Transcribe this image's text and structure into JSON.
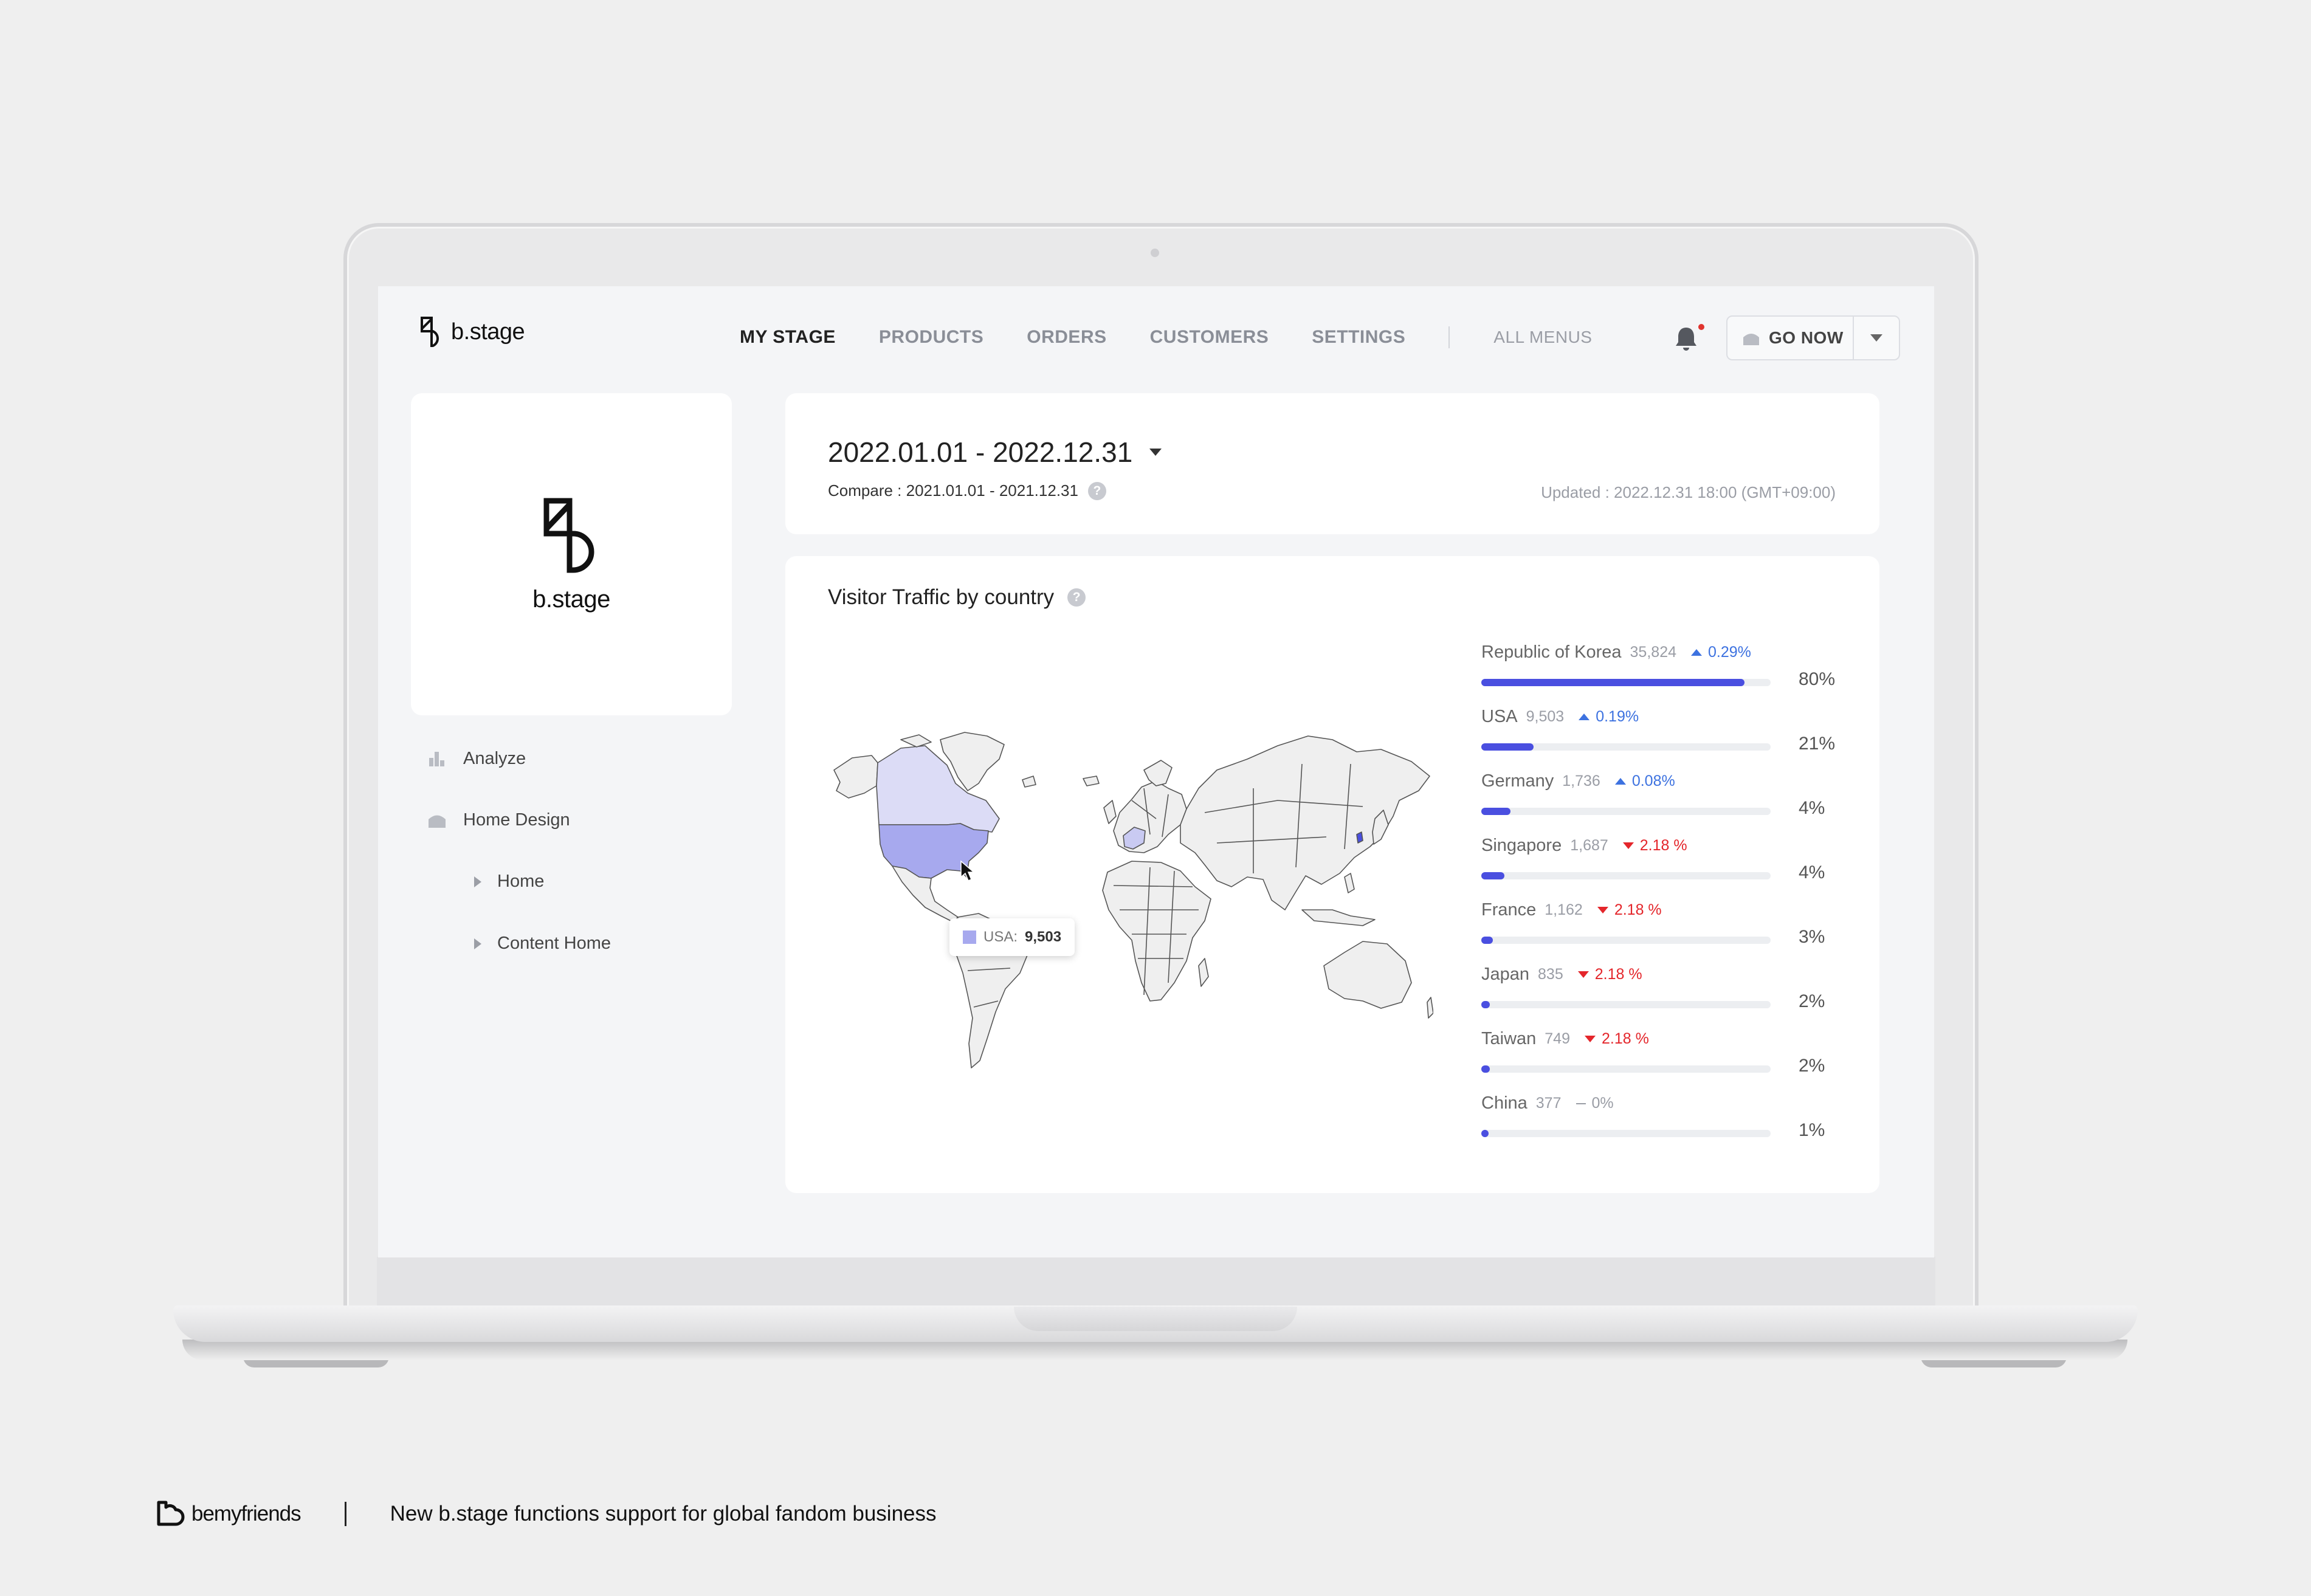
{
  "app": {
    "logo_text": "b.stage"
  },
  "nav": {
    "items": [
      "MY STAGE",
      "PRODUCTS",
      "ORDERS",
      "CUSTOMERS",
      "SETTINGS"
    ],
    "all_menus": "ALL MENUS",
    "go_now": "GO NOW"
  },
  "brand": {
    "name": "b.stage"
  },
  "sidebar": {
    "analyze": "Analyze",
    "home_design": "Home Design",
    "home": "Home",
    "content_home": "Content Home"
  },
  "date": {
    "range": "2022.01.01 - 2022.12.31",
    "compare": "Compare : 2021.01.01 - 2021.12.31",
    "updated": "Updated : 2022.12.31 18:00 (GMT+09:00)"
  },
  "traffic": {
    "title": "Visitor Traffic by country",
    "tooltip": {
      "name": "USA:",
      "value": "9,503"
    },
    "countries": [
      {
        "name": "Republic of Korea",
        "count": "35,824",
        "change": "0.29%",
        "dir": "up",
        "percent": "80%",
        "share": 0.91
      },
      {
        "name": "USA",
        "count": "9,503",
        "change": "0.19%",
        "dir": "up",
        "percent": "21%",
        "share": 0.18
      },
      {
        "name": "Germany",
        "count": "1,736",
        "change": "0.08%",
        "dir": "up",
        "percent": "4%",
        "share": 0.1
      },
      {
        "name": "Singapore",
        "count": "1,687",
        "change": "2.18 %",
        "dir": "down",
        "percent": "4%",
        "share": 0.08
      },
      {
        "name": "France",
        "count": "1,162",
        "change": "2.18 %",
        "dir": "down",
        "percent": "3%",
        "share": 0.04
      },
      {
        "name": "Japan",
        "count": "835",
        "change": "2.18 %",
        "dir": "down",
        "percent": "2%",
        "share": 0.03
      },
      {
        "name": "Taiwan",
        "count": "749",
        "change": "2.18 %",
        "dir": "down",
        "percent": "2%",
        "share": 0.03
      },
      {
        "name": "China",
        "count": "377",
        "change": "0%",
        "dir": "flat",
        "percent": "1%",
        "share": 0.02
      }
    ]
  },
  "caption": {
    "company": "bemyfriends",
    "text": "New b.stage functions support for global fandom business"
  },
  "colors": {
    "accent": "#4a4fe0",
    "up": "#3d72e0",
    "down": "#e4262b",
    "map_usa": "#a7a9ee",
    "map_canada": "#dcdcf6"
  }
}
